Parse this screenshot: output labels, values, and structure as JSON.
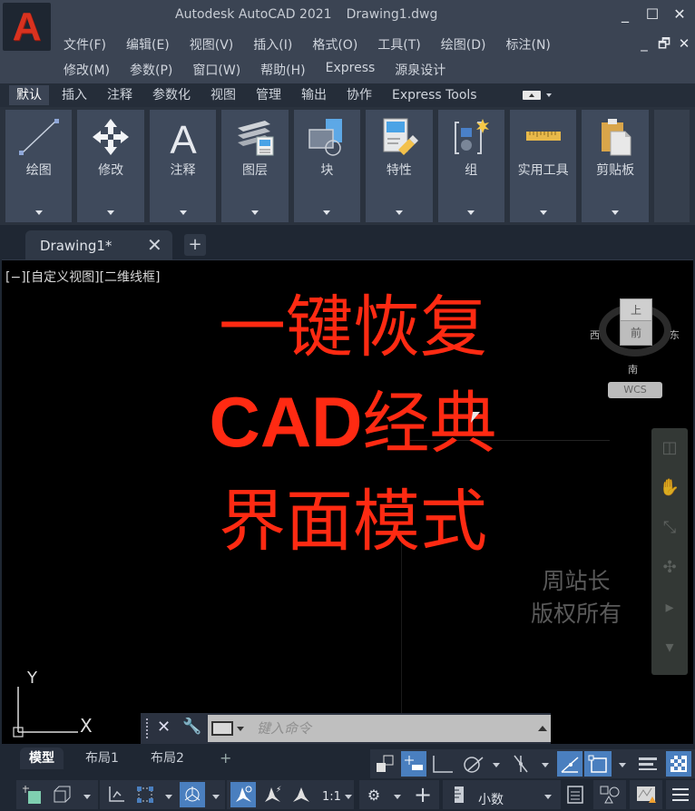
{
  "app": {
    "logo_letter": "A",
    "title": "Autodesk AutoCAD 2021",
    "filename": "Drawing1.dwg",
    "window_controls": {
      "minimize": "_",
      "maximize": "☐",
      "close": "✕"
    },
    "doc_controls": {
      "minimize": "_",
      "restore": "🗗",
      "close": "✕"
    }
  },
  "menu": {
    "row1": [
      "文件(F)",
      "编辑(E)",
      "视图(V)",
      "插入(I)",
      "格式(O)",
      "工具(T)",
      "绘图(D)",
      "标注(N)"
    ],
    "row2": [
      "修改(M)",
      "参数(P)",
      "窗口(W)",
      "帮助(H)",
      "Express",
      "源泉设计"
    ]
  },
  "ribbon": {
    "tabs": [
      {
        "label": "默认",
        "active": true
      },
      {
        "label": "插入",
        "active": false
      },
      {
        "label": "注释",
        "active": false
      },
      {
        "label": "参数化",
        "active": false
      },
      {
        "label": "视图",
        "active": false
      },
      {
        "label": "管理",
        "active": false
      },
      {
        "label": "输出",
        "active": false
      },
      {
        "label": "协作",
        "active": false
      },
      {
        "label": "Express Tools",
        "active": false
      }
    ],
    "panels": [
      {
        "label": "绘图",
        "icon": "line-icon"
      },
      {
        "label": "修改",
        "icon": "move-icon"
      },
      {
        "label": "注释",
        "icon": "text-icon"
      },
      {
        "label": "图层",
        "icon": "layers-icon"
      },
      {
        "label": "块",
        "icon": "block-icon"
      },
      {
        "label": "特性",
        "icon": "properties-icon"
      },
      {
        "label": "组",
        "icon": "group-icon"
      },
      {
        "label": "实用工具",
        "icon": "measure-icon"
      },
      {
        "label": "剪贴板",
        "icon": "clipboard-icon"
      }
    ]
  },
  "document_tab": {
    "label": "Drawing1*",
    "close": "✕",
    "add": "+"
  },
  "canvas": {
    "viewport_label": "[−][自定义视图][二维线框]",
    "headline": [
      "一键恢复",
      "CAD",
      "经典",
      "界面模式"
    ],
    "headline_color": "#ff2a12",
    "watermark": [
      "周站长",
      "版权所有"
    ],
    "viewcube": {
      "top": "上",
      "front": "前",
      "west": "西",
      "east": "东",
      "south": "南",
      "wcs": "WCS"
    },
    "ucs": {
      "x": "X",
      "y": "Y"
    }
  },
  "command_line": {
    "placeholder": "键入命令"
  },
  "layout_tabs": [
    "模型",
    "布局1",
    "布局2",
    "+"
  ],
  "status_bar": {
    "scale": "1:1",
    "units": "小数",
    "accent_color": "#4a7fbf"
  }
}
